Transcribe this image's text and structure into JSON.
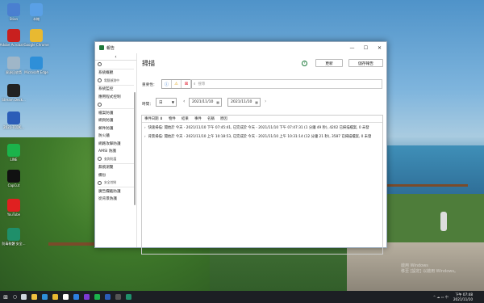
{
  "desktop": {
    "icons": [
      {
        "label": "Stian",
        "color": "#4a7fd0"
      },
      {
        "label": "本機",
        "color": "#5aa0e6"
      },
      {
        "label": "Adobe Acrobat ...",
        "color": "#c8201f"
      },
      {
        "label": "Google Chrome",
        "color": "#e8b931"
      },
      {
        "label": "資源回收筒",
        "color": "#9fb6c8"
      },
      {
        "label": "Microsoft Edge",
        "color": "#2e8fd8"
      },
      {
        "label": "Stream Deck...",
        "color": "#222222"
      },
      {
        "label": "2021-TCDK...",
        "color": "#2b5db8"
      },
      {
        "label": "LINE",
        "color": "#1bb34b"
      },
      {
        "label": "CapCut",
        "color": "#111111"
      },
      {
        "label": "YouTube",
        "color": "#e02020"
      },
      {
        "label": "防毒軟體 安全...",
        "color": "#1f8f6a"
      }
    ],
    "watermark_line1": "啟用 Windows",
    "watermark_line2": "移至 [設定] 以啟用 Windows。"
  },
  "window": {
    "title": "報告",
    "controls": {
      "minimize": "—",
      "maximize": "☐",
      "close": "✕"
    }
  },
  "sidebar": {
    "back": "‹",
    "items": [
      {
        "label": "O",
        "kind": "icon"
      },
      {
        "label": "系統概觀",
        "kind": "text"
      },
      {
        "label": "電腦偵測中",
        "kind": "small-icon"
      },
      {
        "label": "系統監控",
        "kind": "text"
      },
      {
        "label": "應用程式控制",
        "kind": "text"
      },
      {
        "label": "O",
        "kind": "icon"
      },
      {
        "label": "檔案防護",
        "kind": "text"
      },
      {
        "label": "網頁防護",
        "kind": "text"
      },
      {
        "label": "郵件防護",
        "kind": "text"
      },
      {
        "label": "防火牆",
        "kind": "text"
      },
      {
        "label": "網路攻擊防護",
        "kind": "text"
      },
      {
        "label": "AMSI 防護",
        "kind": "text"
      },
      {
        "label": "查詢防護",
        "kind": "small-icon"
      },
      {
        "label": "無痕瀏覽",
        "kind": "text"
      },
      {
        "label": "備份",
        "kind": "text"
      },
      {
        "label": "安全控制",
        "kind": "small-icon"
      },
      {
        "label": "廣告攔截防護",
        "kind": "text"
      },
      {
        "label": "從背景防護",
        "kind": "text"
      }
    ]
  },
  "main": {
    "title": "掃描",
    "help": "?",
    "update_button": "更新",
    "save_report_button": "儲存報告",
    "severity_label": "重要性：",
    "severity_icons": {
      "info": "ⓘ",
      "warning": "⚠",
      "error": "⊠"
    },
    "search_placeholder": "搜尋",
    "time_label": "時間：",
    "period_value": "日",
    "date_from": "2021/11/10",
    "date_to": "2021/11/10",
    "nav_prev": "‹",
    "nav_next": "›",
    "table": {
      "columns": [
        "事件日期 ⬇",
        "物件",
        "結果",
        "事件",
        "名稱",
        "原因"
      ],
      "rows": [
        "快速掃描: 開始於 今天 - 2021/11/10 下午 07:45:41, 已完成於 今天 - 2021/11/10 下午 07:47:31 (1 分鐘 49 秒), 4202 已掃描檔案, 0 未發",
        "背景掃描: 開始於 今天 - 2021/11/10 上午 10:18:53, 已完成於 今天 - 2021/11/10 上午 10:31:14 (12 分鐘 21 秒), 3587 已掃描檔案, 0 未發"
      ]
    }
  },
  "taskbar": {
    "start": "⊞",
    "search": "○",
    "apps": [
      {
        "name": "task-view",
        "color": "#cfd6de"
      },
      {
        "name": "file-explorer",
        "color": "#f0c040"
      },
      {
        "name": "edge",
        "color": "#2e8fd8"
      },
      {
        "name": "chrome",
        "color": "#e8b931"
      },
      {
        "name": "capcut",
        "color": "#ffffff"
      },
      {
        "name": "photoshop",
        "color": "#2d7fe0"
      },
      {
        "name": "premiere",
        "color": "#7c3ad4"
      },
      {
        "name": "line",
        "color": "#1bb34b"
      },
      {
        "name": "word",
        "color": "#2b5db8"
      },
      {
        "name": "stream-deck",
        "color": "#555555"
      },
      {
        "name": "security-app",
        "color": "#1f8f6a"
      }
    ],
    "time": "下午 07:48",
    "date": "2021/11/10",
    "systray": "^ ☁ ▭ 中"
  }
}
